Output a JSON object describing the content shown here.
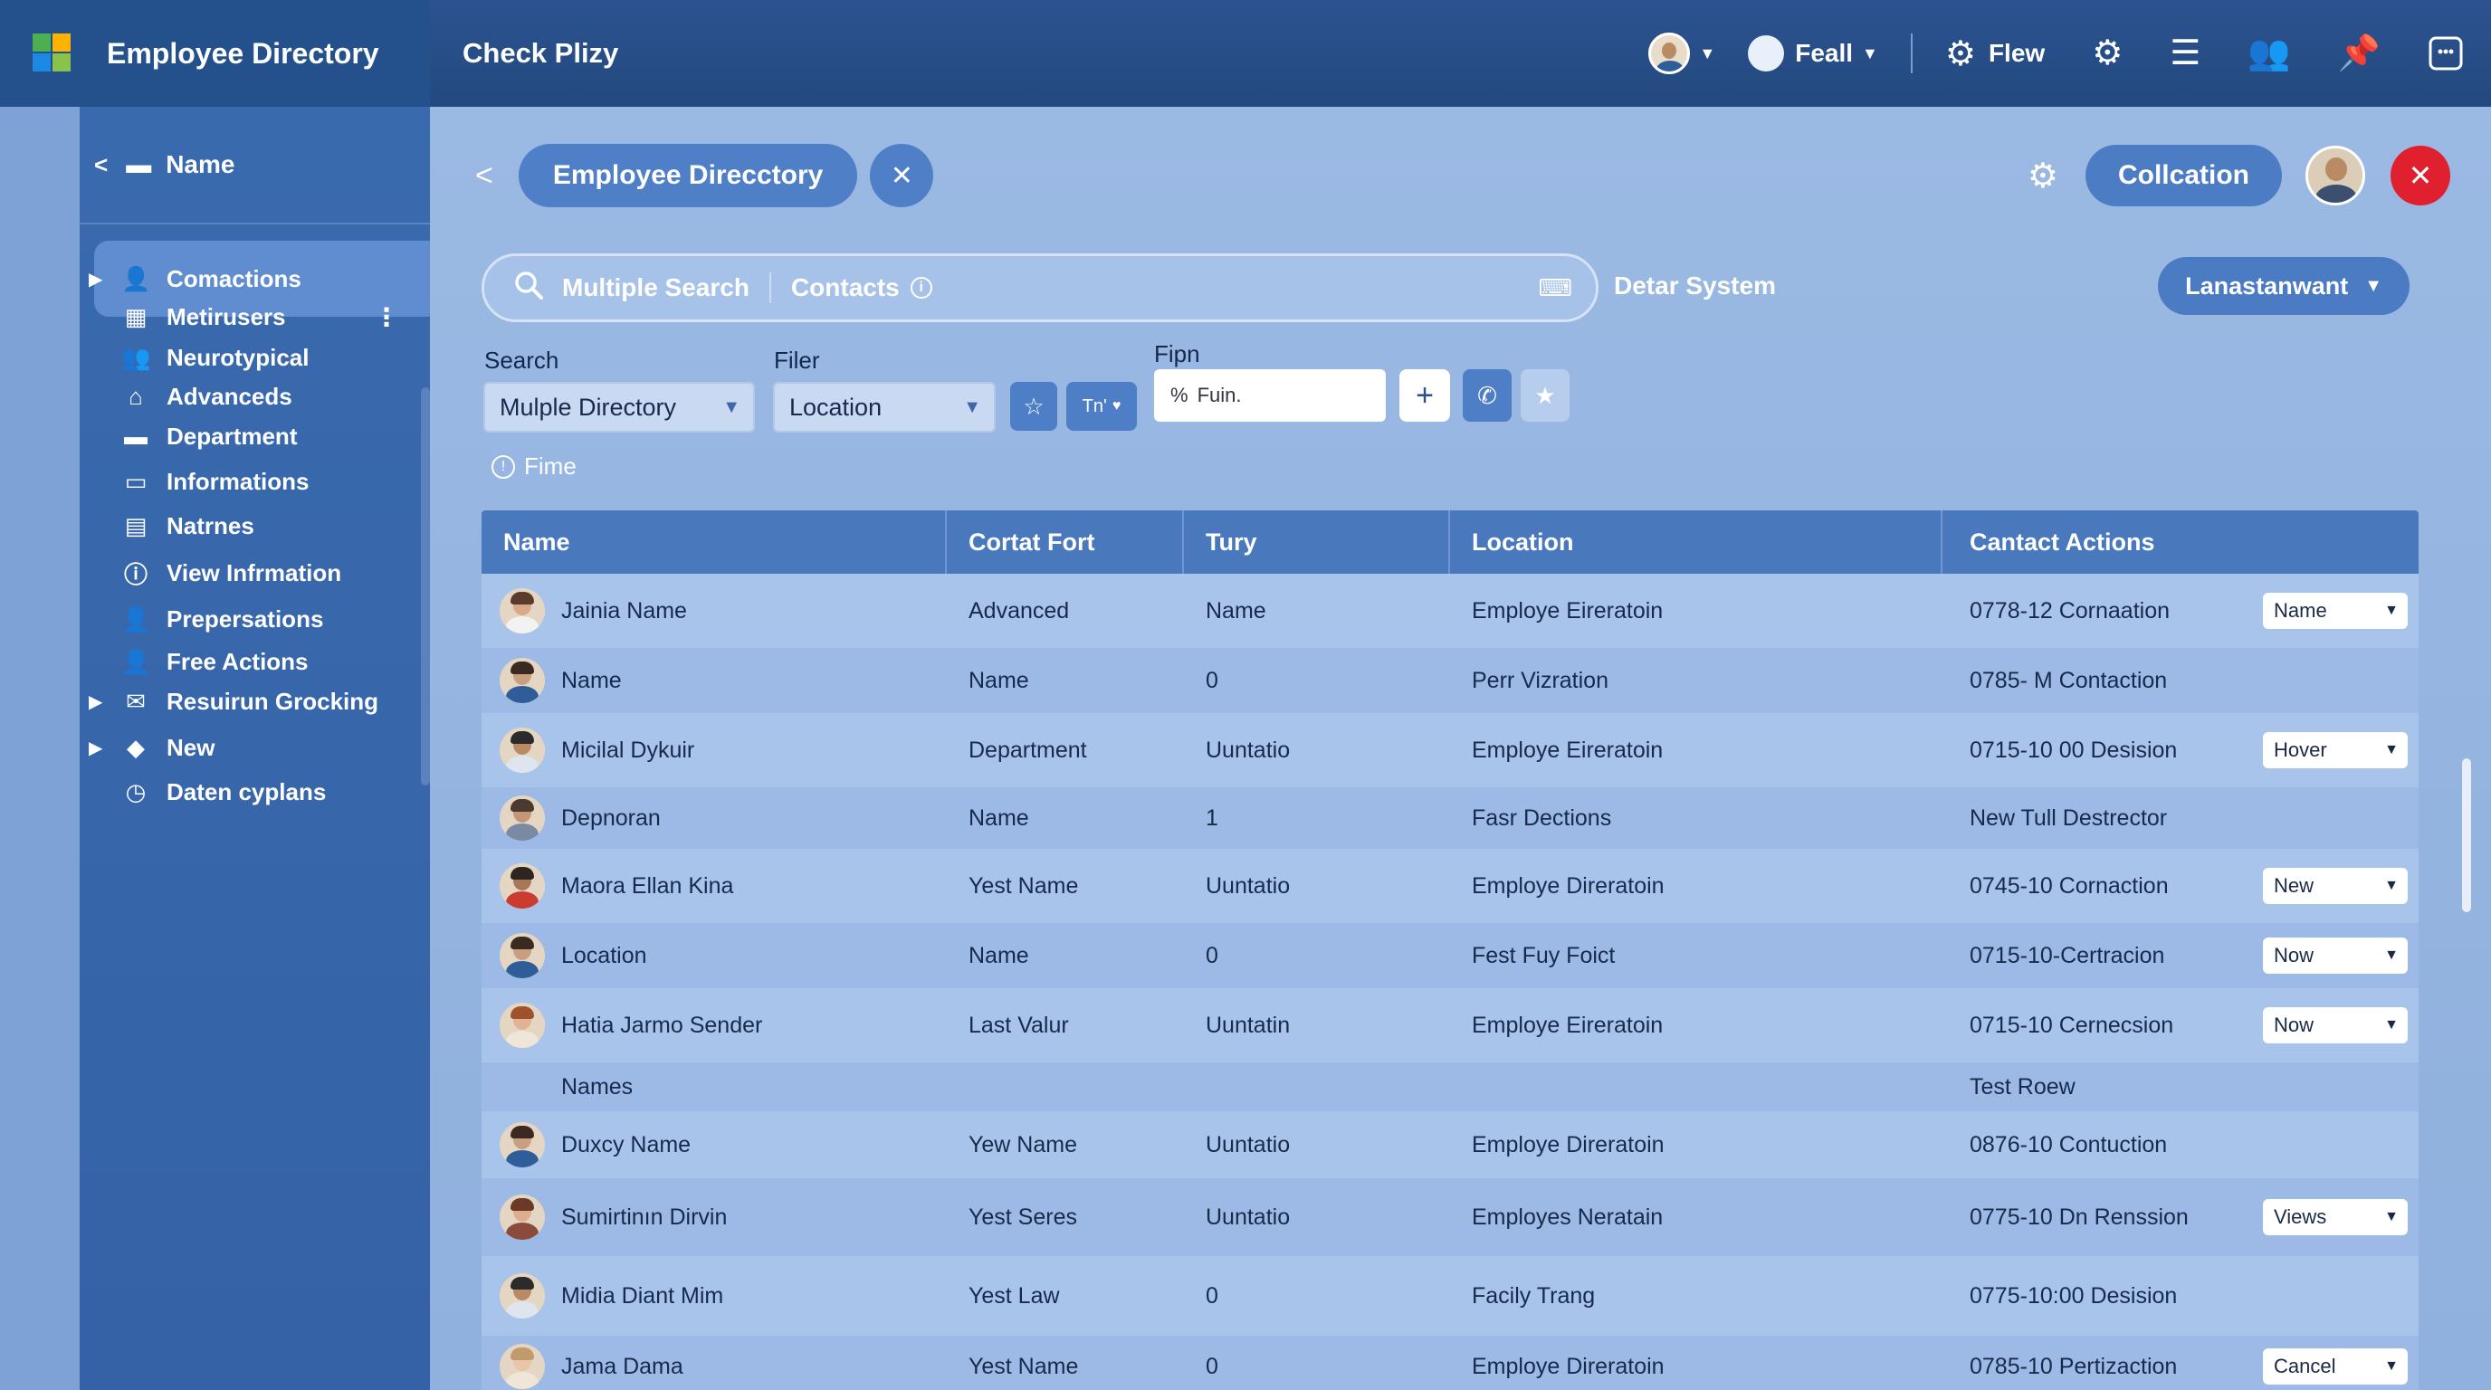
{
  "topbar": {
    "app_title": "Employee Directory",
    "subtitle": "Check Plizy",
    "user_menu": "Feall",
    "flew_label": "Flew",
    "icons": [
      "avatar",
      "gear-icon",
      "list-icon",
      "people-icon",
      "pin-icon",
      "window-icon"
    ]
  },
  "sidebar": {
    "top_label": "Name",
    "items": [
      {
        "label": "Comactions",
        "icon": "person-icon",
        "active": true,
        "expandable": true
      },
      {
        "label": "Metirusers",
        "icon": "grid-icon",
        "menu": true
      },
      {
        "label": "Neurotypical",
        "icon": "people-icon"
      },
      {
        "label": "Advanceds",
        "icon": "home-icon"
      },
      {
        "label": "Department",
        "icon": "folder-icon"
      },
      {
        "label": "Informations",
        "icon": "monitor-icon"
      },
      {
        "label": "Natrnes",
        "icon": "card-icon"
      },
      {
        "label": "View Infrmation",
        "icon": "info-icon"
      },
      {
        "label": "Prepersations",
        "icon": "person-icon"
      },
      {
        "label": "Free Actions",
        "icon": "person-icon"
      },
      {
        "label": "Resuirun Grocking",
        "icon": "mail-icon",
        "expandable": true
      },
      {
        "label": "New",
        "icon": "diamond-icon",
        "expandable": true
      },
      {
        "label": "Daten cyplans",
        "icon": "clock-icon"
      }
    ]
  },
  "header": {
    "title": "Employee Direcctory",
    "collection_button": "Collcation"
  },
  "search": {
    "label": "Multiple Search",
    "contacts_label": "Contacts",
    "detar_label": "Detar System",
    "lang_button": "Lanastanwant"
  },
  "filters": {
    "search_label": "Search",
    "search_value": "Mulple Directory",
    "filer_label": "Filer",
    "filer_value": "Location",
    "tag_button": "Tn'",
    "fipn_label": "Fipn",
    "fipn_value": "Fuin.",
    "fime_label": "Fime"
  },
  "table": {
    "columns": [
      "Name",
      "Cortat Fort",
      "Tury",
      "Location",
      "Cantact Actions"
    ],
    "rows": [
      {
        "name": "Jainia Name",
        "fort": "Advanced",
        "tury": "Name",
        "location": "Employe Eireratoin",
        "contact": "0778-12 Cornaation",
        "action": "Name",
        "avatar": "f1"
      },
      {
        "name": "Name",
        "fort": "Name",
        "tury": "0",
        "location": "Perr Vizration",
        "contact": "0785- M Contaction",
        "action": "",
        "avatar": "m1"
      },
      {
        "name": "Micilal Dykuir",
        "fort": "Department",
        "tury": "Uuntatio",
        "location": "Employe Eireratoin",
        "contact": "0715-10 00 Desision",
        "action": "Hover",
        "avatar": "m2"
      },
      {
        "name": "Depnoran",
        "fort": "Name",
        "tury": "1",
        "location": "Fasr Dections",
        "contact": "New Tull Destrector",
        "action": "",
        "avatar": "m3"
      },
      {
        "name": "Maora Ellan Kina",
        "fort": "Yest Name",
        "tury": "Uuntatio",
        "location": "Employe Direratoin",
        "contact": "0745-10 Cornaction",
        "action": "New",
        "avatar": "m4"
      },
      {
        "name": "Location",
        "fort": "Name",
        "tury": "0",
        "location": "Fest Fuy Foict",
        "contact": "0715-10-Certracion",
        "action": "Now",
        "avatar": "m1"
      },
      {
        "name": "Hatia Jarmo Sender",
        "fort": "Last Valur",
        "tury": "Uuntatin",
        "location": "Employe Eireratoin",
        "contact": "0715-10 Cernecsion",
        "action": "Now",
        "avatar": "f2"
      },
      {
        "name": "Names",
        "fort": "",
        "tury": "",
        "location": "",
        "contact": "Test Roew",
        "action": "",
        "avatar": ""
      },
      {
        "name": "Duxcy Name",
        "fort": "Yew Name",
        "tury": "Uuntatio",
        "location": "Employe Direratoin",
        "contact": "0876-10 Contuction",
        "action": "",
        "avatar": "m1"
      },
      {
        "name": "Sumirtinın Dirvin",
        "fort": "Yest Seres",
        "tury": "Uuntatio",
        "location": "Employes Neratain",
        "contact": "0775-10 Dn Renssion",
        "action": "Views",
        "avatar": "f3"
      },
      {
        "name": "Midia Diant Mim",
        "fort": "Yest Law",
        "tury": "0",
        "location": "Facily Trang",
        "contact": "0775-10:00 Desision",
        "action": "",
        "avatar": "m2"
      },
      {
        "name": "Jama Dama",
        "fort": "Yest Name",
        "tury": "0",
        "location": "Employe Direratoin",
        "contact": "0785-10 Pertizaction",
        "action": "Cancel",
        "avatar": "f4"
      }
    ]
  },
  "colors": {
    "topbar": "#23497f",
    "sidebar": "#3a6aae",
    "main_bg": "#9ab9e3",
    "accent": "#4c7cc3",
    "close": "#e0202f"
  }
}
